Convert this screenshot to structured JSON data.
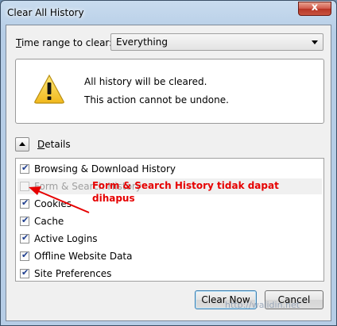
{
  "window": {
    "title": "Clear All History",
    "close_symbol": "x"
  },
  "time_range": {
    "label_prefix": "T",
    "label_rest": "ime range to clear:",
    "selected": "Everything"
  },
  "warning": {
    "line1": "All history will be cleared.",
    "line2": "This action cannot be undone.",
    "icon": "warning-icon"
  },
  "details": {
    "label_prefix": "D",
    "label_rest": "etails"
  },
  "items": [
    {
      "label": "Browsing & Download History",
      "checked": true,
      "disabled": false
    },
    {
      "label": "Form & Search History",
      "checked": false,
      "disabled": true
    },
    {
      "label": "Cookies",
      "checked": true,
      "disabled": false
    },
    {
      "label": "Cache",
      "checked": true,
      "disabled": false
    },
    {
      "label": "Active Logins",
      "checked": true,
      "disabled": false
    },
    {
      "label": "Offline Website Data",
      "checked": true,
      "disabled": false
    },
    {
      "label": "Site Preferences",
      "checked": true,
      "disabled": false
    }
  ],
  "annotation": {
    "line1": "Form & Search History tidak dapat",
    "line2": "dihapus",
    "color": "#e60000"
  },
  "buttons": {
    "clear_now": "Clear Now",
    "cancel": "Cancel"
  },
  "watermark": "http://walidin.net"
}
